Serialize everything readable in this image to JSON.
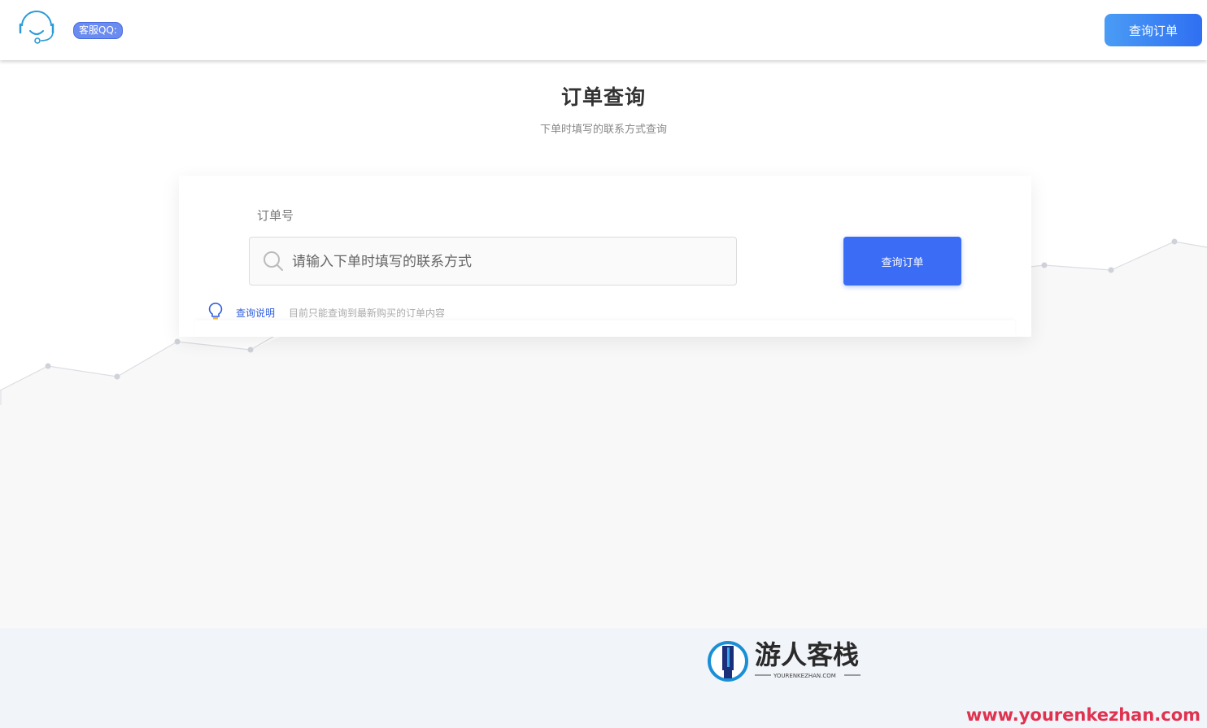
{
  "header": {
    "support_label": "客服QQ:",
    "query_button": "查询订单"
  },
  "page": {
    "title": "订单查询",
    "subtitle": "下单时填写的联系方式查询"
  },
  "form": {
    "field_label": "订单号",
    "input_placeholder": "请输入下单时填写的联系方式",
    "input_value": "",
    "submit_label": "查询订单"
  },
  "tip": {
    "link_label": "查询说明",
    "text": "目前只能查询到最新购买的订单内容"
  },
  "footer": {
    "logo_text": "游人客栈",
    "logo_domain": "YOURENKEZHAN.COM",
    "watermark": "www.yourenkezhan.com"
  },
  "colors": {
    "accent": "#3a6cf6",
    "header_button_gradient": [
      "#4a9cf5",
      "#2f6ff2"
    ],
    "badge": "#6a8bf0",
    "footer_bg": "#f1f4f9",
    "watermark": "#e0324f"
  }
}
